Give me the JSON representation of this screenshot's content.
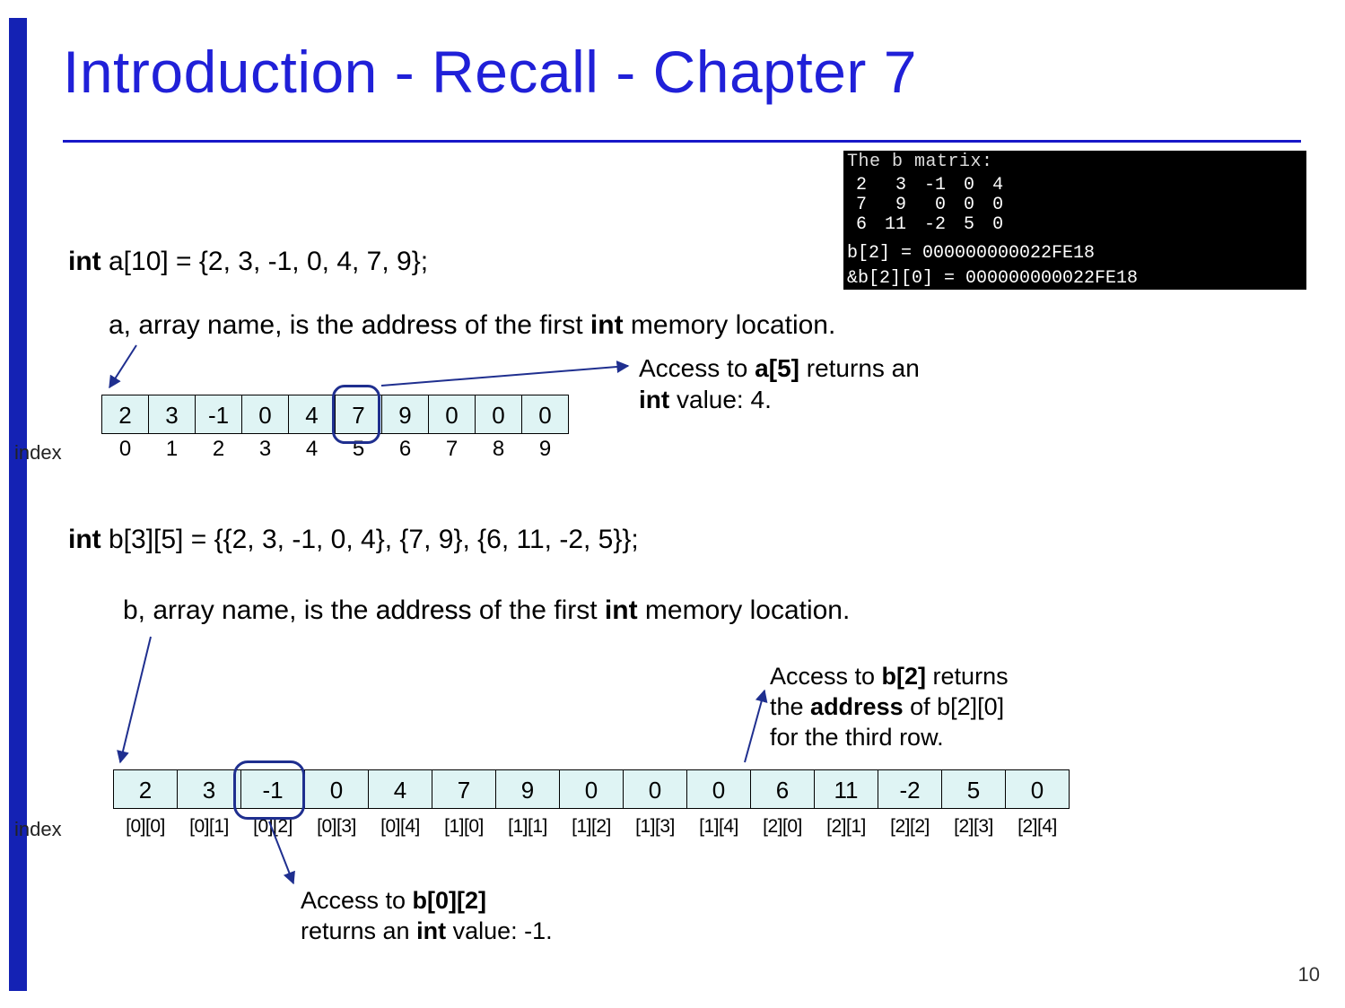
{
  "title": "Introduction - Recall - Chapter 7",
  "console": {
    "header": "The b matrix:",
    "rows": [
      [
        "2",
        "3",
        "-1",
        "0",
        "4"
      ],
      [
        "7",
        "9",
        "0",
        "0",
        "0"
      ],
      [
        "6",
        "11",
        "-2",
        "5",
        "0"
      ]
    ],
    "l1": "b[2] = 000000000022FE18",
    "l2": "&b[2][0] = 000000000022FE18"
  },
  "declA_kw": "int",
  "declA_rest": " a[10] = {2, 3, -1, 0, 4, 7, 9};",
  "explA_pre": "a, array name, is the ",
  "explA_addr": "address",
  "explA_post": " of the first ",
  "explA_int": "int",
  "explA_tail": " memory location.",
  "arrA": [
    "2",
    "3",
    "-1",
    "0",
    "4",
    "7",
    "9",
    "0",
    "0",
    "0"
  ],
  "idxA": [
    "0",
    "1",
    "2",
    "3",
    "4",
    "5",
    "6",
    "7",
    "8",
    "9"
  ],
  "indexLabelA": "index",
  "annA_l1a": "Access to ",
  "annA_l1b": "a[5]",
  "annA_l1c": " returns an",
  "annA_l2a": "int",
  "annA_l2b": " value: 4.",
  "declB_kw": "int",
  "declB_rest": " b[3][5] = {{2, 3, -1, 0, 4}, {7, 9}, {6, 11, -2, 5}};",
  "explB_pre": "b, array name, is the ",
  "explB_addr": "address",
  "explB_post": " of the first ",
  "explB_int": "int",
  "explB_tail": " memory location.",
  "arrB": [
    "2",
    "3",
    "-1",
    "0",
    "4",
    "7",
    "9",
    "0",
    "0",
    "0",
    "6",
    "11",
    "-2",
    "5",
    "0"
  ],
  "idxB": [
    "[0][0]",
    "[0][1]",
    "[0][2]",
    "[0][3]",
    "[0][4]",
    "[1][0]",
    "[1][1]",
    "[1][2]",
    "[1][3]",
    "[1][4]",
    "[2][0]",
    "[2][1]",
    "[2][2]",
    "[2][3]",
    "[2][4]"
  ],
  "indexLabelB": "index",
  "annB1_l1a": "Access to ",
  "annB1_l1b": "b[2]",
  "annB1_l1c": " returns",
  "annB1_l2a": "the ",
  "annB1_l2b": "address",
  "annB1_l2c": " of b[2][0]",
  "annB1_l3": "for the third row.",
  "annB2_l1a": "Access to ",
  "annB2_l1b": "b[0][2]",
  "annB2_l2a": "returns an ",
  "annB2_l2b": "int",
  "annB2_l2c": " value: -1.",
  "pagenum": "10"
}
